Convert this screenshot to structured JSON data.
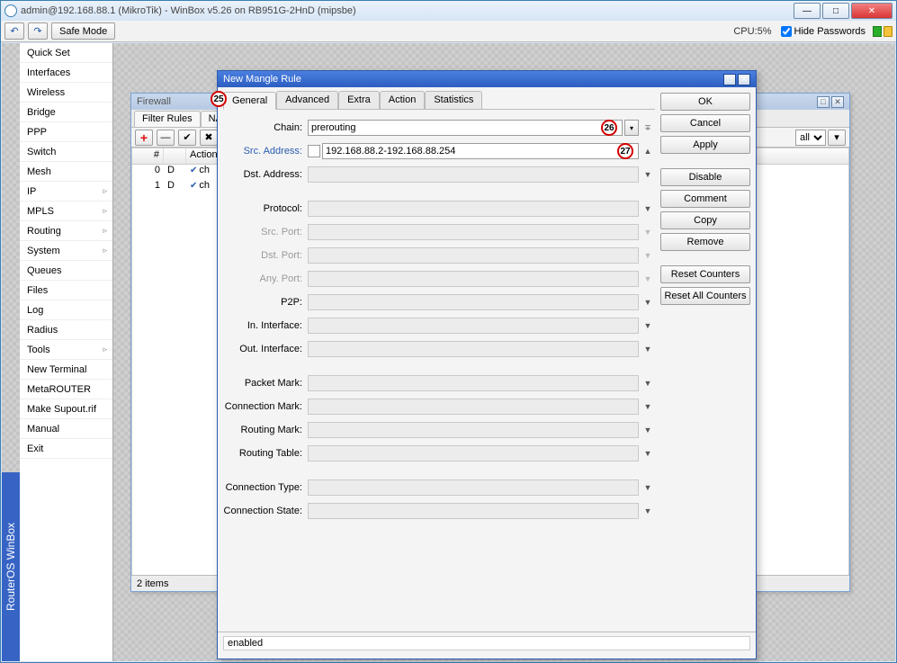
{
  "window_title": "admin@192.168.88.1 (MikroTik) - WinBox v5.26 on RB951G-2HnD (mipsbe)",
  "toolbar": {
    "safe_mode": "Safe Mode",
    "cpu_label": "CPU:",
    "cpu_value": "5%",
    "hide_passwords": "Hide Passwords"
  },
  "brand": "RouterOS WinBox",
  "menu": {
    "items": [
      "Quick Set",
      "Interfaces",
      "Wireless",
      "Bridge",
      "PPP",
      "Switch",
      "Mesh",
      "IP",
      "MPLS",
      "Routing",
      "System",
      "Queues",
      "Files",
      "Log",
      "Radius",
      "Tools",
      "New Terminal",
      "MetaROUTER",
      "Make Supout.rif",
      "Manual",
      "Exit"
    ],
    "submenu_flags": [
      false,
      false,
      false,
      false,
      false,
      false,
      false,
      true,
      true,
      true,
      true,
      false,
      false,
      false,
      false,
      true,
      false,
      false,
      false,
      false,
      false
    ]
  },
  "firewall": {
    "title": "Firewall",
    "tabs": [
      "Filter Rules",
      "NA"
    ],
    "filter_all": "all",
    "table": {
      "headers": [
        "#",
        "",
        "Action"
      ],
      "rows": [
        {
          "n": "0",
          "flag": "D",
          "action": "ch"
        },
        {
          "n": "1",
          "flag": "D",
          "action": "ch"
        }
      ]
    },
    "items": "2 items"
  },
  "mangle": {
    "title": "New Mangle Rule",
    "tabs": [
      "General",
      "Advanced",
      "Extra",
      "Action",
      "Statistics"
    ],
    "active_tab": 0,
    "fields": {
      "chain_label": "Chain:",
      "chain_value": "prerouting",
      "src_addr_label": "Src. Address:",
      "src_addr_value": "192.168.88.2-192.168.88.254",
      "dst_addr_label": "Dst. Address:",
      "protocol_label": "Protocol:",
      "src_port_label": "Src. Port:",
      "dst_port_label": "Dst. Port:",
      "any_port_label": "Any. Port:",
      "p2p_label": "P2P:",
      "in_if_label": "In. Interface:",
      "out_if_label": "Out. Interface:",
      "packet_mark_label": "Packet Mark:",
      "conn_mark_label": "Connection Mark:",
      "routing_mark_label": "Routing Mark:",
      "routing_table_label": "Routing Table:",
      "conn_type_label": "Connection Type:",
      "conn_state_label": "Connection State:"
    },
    "buttons": {
      "ok": "OK",
      "cancel": "Cancel",
      "apply": "Apply",
      "disable": "Disable",
      "comment": "Comment",
      "copy": "Copy",
      "remove": "Remove",
      "reset_counters": "Reset Counters",
      "reset_all": "Reset All Counters"
    },
    "status": "enabled"
  },
  "annotations": {
    "a25": "25",
    "a26": "26",
    "a27": "27"
  }
}
